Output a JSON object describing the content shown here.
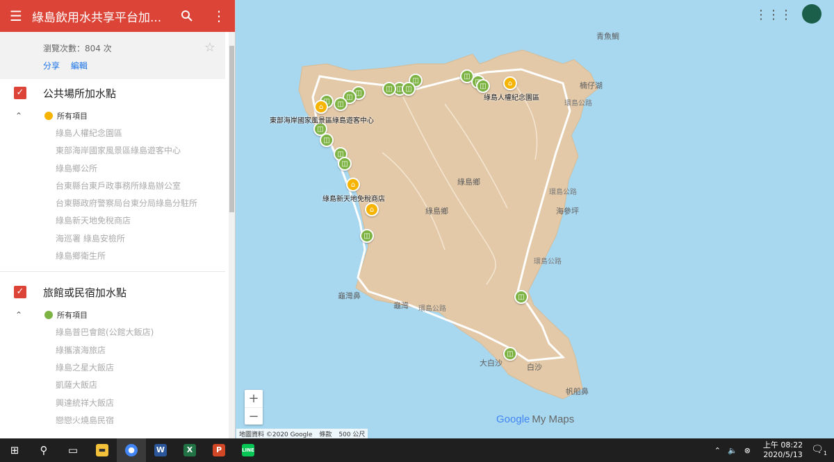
{
  "app": {
    "title": "綠島飲用水共享平台加...",
    "views": "瀏覽次數：804 次",
    "share_label": "分享",
    "edit_label": "編輯"
  },
  "layers": [
    {
      "title": "公共場所加水點",
      "group_label": "所有項目",
      "group_color": "#f6b400",
      "items": [
        "綠島人權紀念園區",
        "東部海岸國家風景區綠島遊客中心",
        "綠島鄉公所",
        "台東縣台東戶政事務所綠島辦公室",
        "台東縣政府警察局台東分局綠島分駐所",
        "綠島新天地免稅商店",
        "海巡署 綠島安檢所",
        "綠島鄉衛生所"
      ]
    },
    {
      "title": "旅館或民宿加水點",
      "group_label": "所有項目",
      "group_color": "#7cb342",
      "items": [
        "綠島普巴會館(公館大飯店)",
        "綠攜濱海旅店",
        "綠島之星大飯店",
        "凱薩大飯店",
        "興達統祥大飯店",
        "戀戀火燒島民宿"
      ]
    }
  ],
  "map": {
    "places": [
      "青魚鯛",
      "楠仔湖",
      "綠島鄉",
      "綠島鄉",
      "海參坪",
      "龜灣鼻",
      "龜灣",
      "大白沙",
      "白沙",
      "帆船鼻"
    ],
    "roads": [
      "環島公路",
      "環島公路",
      "環島公路",
      "環島公路"
    ],
    "poi_labels": [
      "綠島人權紀念園區",
      "東部海岸國家風景區綠島遊客中心",
      "綠島新天地免稅商店"
    ],
    "zoom_in": "+",
    "zoom_out": "−",
    "logo_google": "Google",
    "logo_mymaps": "My Maps",
    "attribution": "地圖資料 ©2020 Google",
    "terms": "條款",
    "scale": "500 公尺",
    "land_color": "#e3c9a8",
    "water_color": "#a8d8f0",
    "green_marker": "#7cb342",
    "yellow_marker": "#f6b400"
  },
  "taskbar": {
    "time": "上午 08:22",
    "date": "2020/5/13",
    "notification_count": "1"
  }
}
